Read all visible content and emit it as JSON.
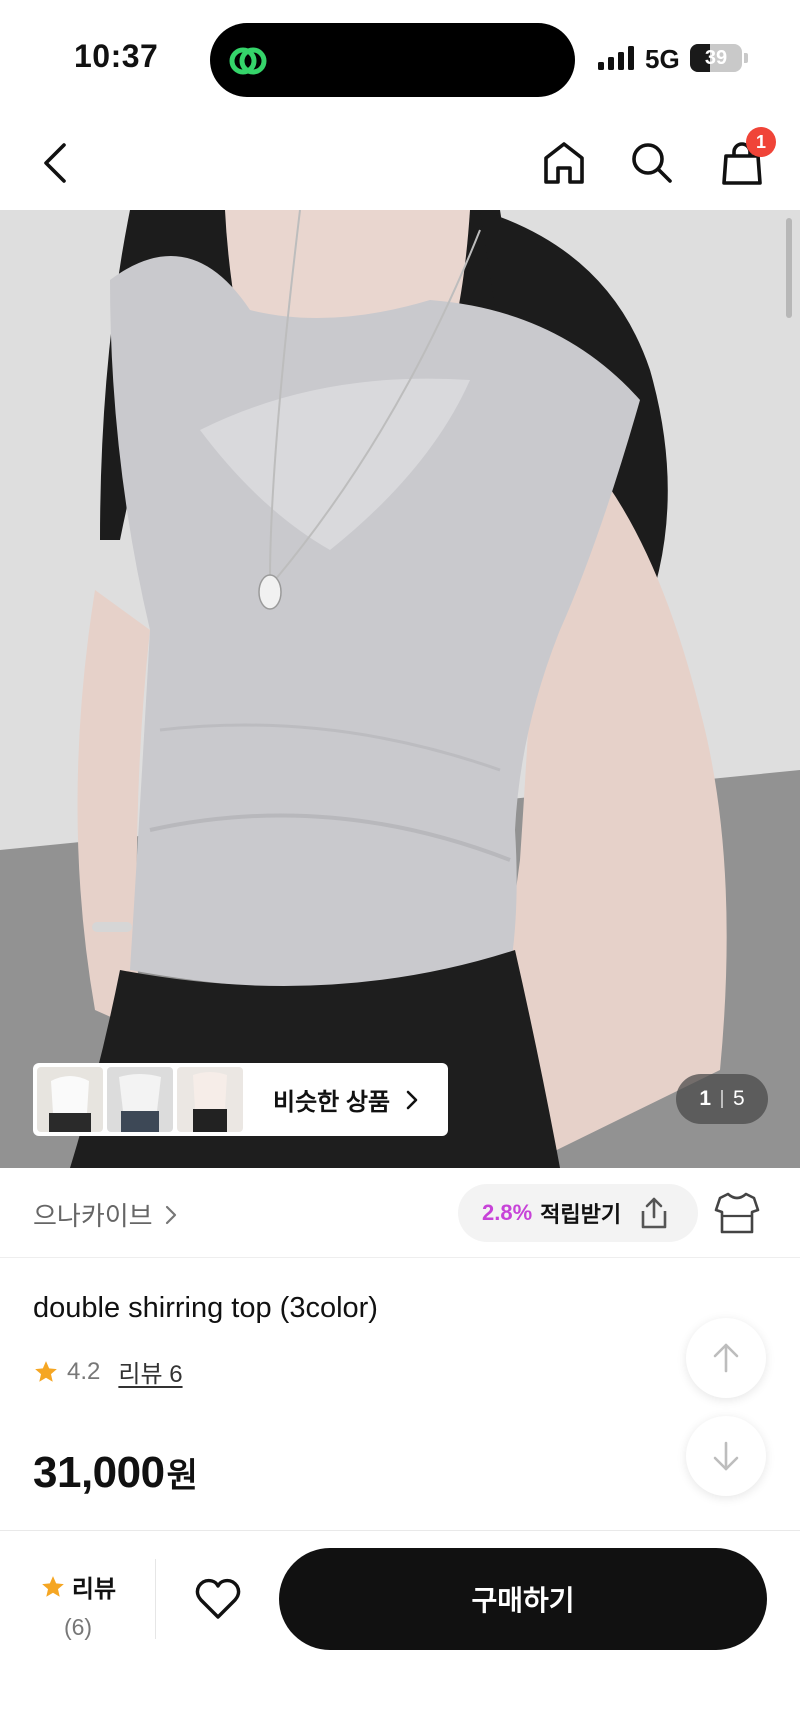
{
  "status_bar": {
    "time": "10:37",
    "network": "5G",
    "battery_level": "39",
    "battery_fraction": 0.39
  },
  "nav": {
    "icons": [
      "back-arrow-icon",
      "home-icon",
      "search-icon",
      "shopping-bag-icon"
    ],
    "cart_count": "1"
  },
  "gallery": {
    "current_page": "1",
    "total_pages": "5",
    "similar_products_label": "비슷한 상품"
  },
  "brand": {
    "name": "으나카이브",
    "points_rate": "2.8%",
    "points_label": "적립받기"
  },
  "product": {
    "title": "double shirring top (3color)",
    "rating": "4.2",
    "review_link": "리뷰 6",
    "price": "31,000",
    "price_unit": "원"
  },
  "bottom_bar": {
    "review_label": "리뷰",
    "review_count": "(6)",
    "buy_label": "구매하기"
  },
  "colors": {
    "accent_points": "#c743d8",
    "badge": "#f04438",
    "star": "#f5a623",
    "buy_button": "#111111"
  }
}
